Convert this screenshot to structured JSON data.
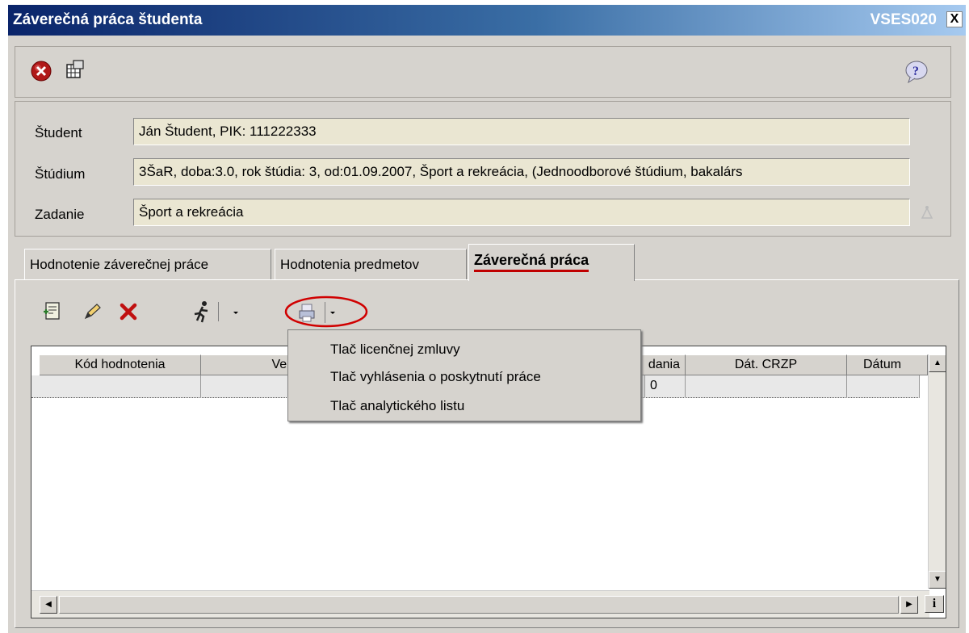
{
  "window": {
    "title": "Záverečná práca študenta",
    "code": "VSES020",
    "close_label": "X"
  },
  "toolbar": {
    "exit_icon": "exit-icon",
    "grid_icon": "grid-icon",
    "help_icon": "help-icon"
  },
  "info": {
    "student_label": "Študent",
    "student_value": "Ján Študent, PIK: 111222333",
    "study_label": "Štúdium",
    "study_value": "3ŠaR, doba:3.0, rok štúdia: 3, od:01.09.2007, Šport a rekreácia, (Jednoodborové štúdium, bakalárs",
    "assignment_label": "Zadanie",
    "assignment_value": "Šport a rekreácia"
  },
  "tabs": [
    {
      "label": "Hodnotenie záverečnej práce"
    },
    {
      "label": "Hodnotenia predmetov"
    },
    {
      "label": "Záverečná práca"
    }
  ],
  "grid": {
    "columns": [
      {
        "label": "Kód hodnotenia"
      },
      {
        "label": "Ver"
      },
      {
        "label": "dania"
      },
      {
        "label": "Dát. CRZP"
      },
      {
        "label": "Dátum"
      }
    ],
    "row_fragment": "0"
  },
  "print_menu": {
    "items": [
      {
        "label": "Tlač licenčnej zmluvy"
      },
      {
        "label": "Tlač vyhlásenia o poskytnutí práce"
      },
      {
        "label": "Tlač analytického listu"
      }
    ]
  },
  "colors": {
    "title_start": "#0a246a",
    "title_end": "#a6caf0",
    "highlight_circle": "#d00000",
    "field_bg": "#eae6d2"
  }
}
